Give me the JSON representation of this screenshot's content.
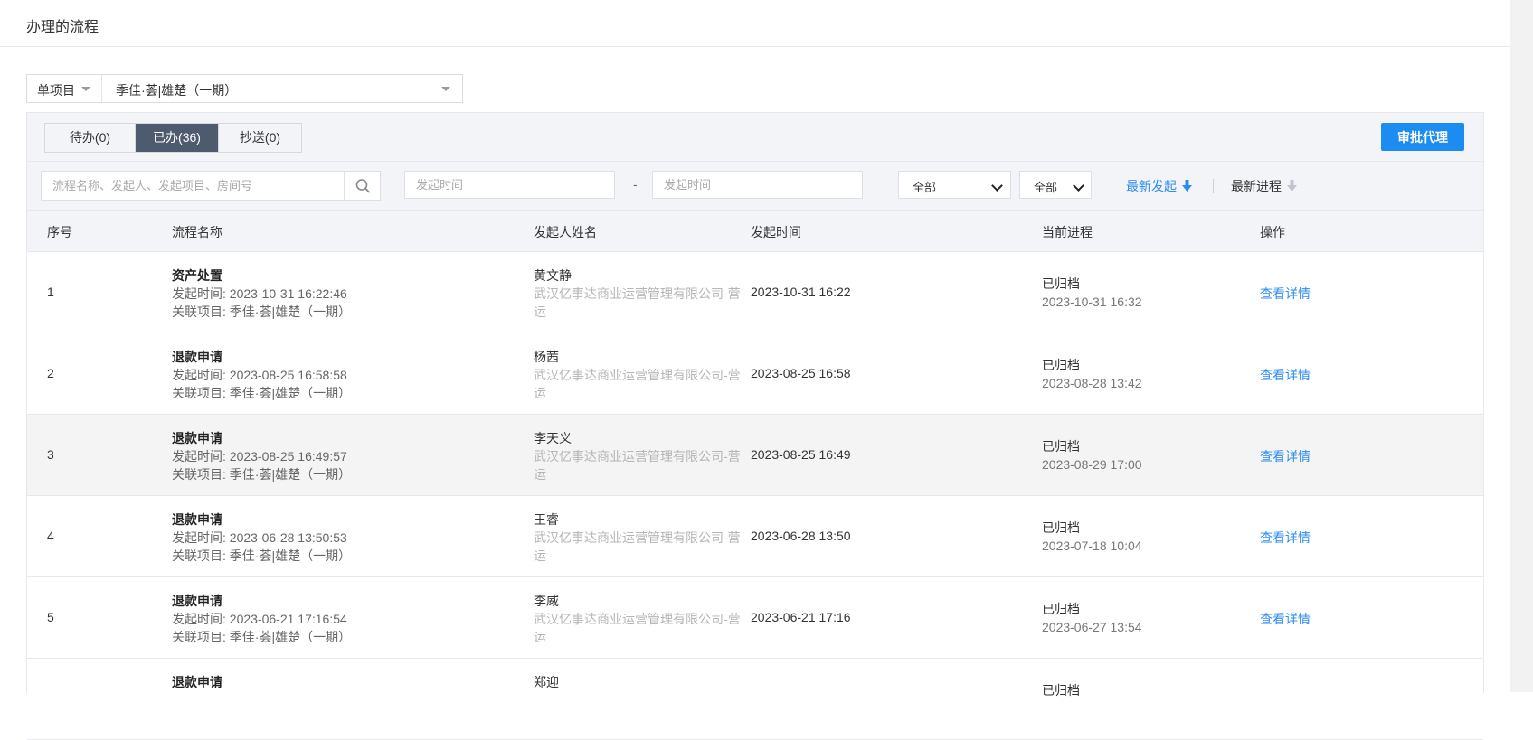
{
  "page": {
    "title": "办理的流程"
  },
  "filters": {
    "project_type": "单项目",
    "project_name": "季佳·荟|雄楚（一期）"
  },
  "tabs": [
    {
      "label": "待办(0)",
      "active": false
    },
    {
      "label": "已办(36)",
      "active": true
    },
    {
      "label": "抄送(0)",
      "active": false
    }
  ],
  "agent_button": "审批代理",
  "search": {
    "placeholder": "流程名称、发起人、发起项目、房间号",
    "start_date_placeholder": "发起时间",
    "end_date_placeholder": "发起时间",
    "separator": "-",
    "select1": "全部",
    "select2": "全部",
    "sort_latest_start": "最新发起",
    "sort_latest_progress": "最新进程"
  },
  "colors": {
    "accent": "#1d8cf0",
    "link": "#2d8cf0",
    "active_tab": "#4e5a6d",
    "sort_inactive": "#c0c4cc"
  },
  "table": {
    "headers": [
      "序号",
      "流程名称",
      "发起人姓名",
      "发起时间",
      "当前进程",
      "操作"
    ],
    "rows": [
      {
        "idx": "1",
        "name": "资产处置",
        "start_line": "发起时间: 2023-10-31 16:22:46",
        "project_line": "关联项目: 季佳·荟|雄楚（一期）",
        "person": "黄文静",
        "org": "武汉亿事达商业运营管理有限公司-营运",
        "time": "2023-10-31 16:22",
        "status": "已归档",
        "status_time": "2023-10-31 16:32",
        "action": "查看详情"
      },
      {
        "idx": "2",
        "name": "退款申请",
        "start_line": "发起时间: 2023-08-25 16:58:58",
        "project_line": "关联项目: 季佳·荟|雄楚（一期）",
        "person": "杨茜",
        "org": "武汉亿事达商业运营管理有限公司-营运",
        "time": "2023-08-25 16:58",
        "status": "已归档",
        "status_time": "2023-08-28 13:42",
        "action": "查看详情"
      },
      {
        "idx": "3",
        "name": "退款申请",
        "start_line": "发起时间: 2023-08-25 16:49:57",
        "project_line": "关联项目: 季佳·荟|雄楚（一期）",
        "person": "李天义",
        "org": "武汉亿事达商业运营管理有限公司-营运",
        "time": "2023-08-25 16:49",
        "status": "已归档",
        "status_time": "2023-08-29 17:00",
        "action": "查看详情"
      },
      {
        "idx": "4",
        "name": "退款申请",
        "start_line": "发起时间: 2023-06-28 13:50:53",
        "project_line": "关联项目: 季佳·荟|雄楚（一期）",
        "person": "王睿",
        "org": "武汉亿事达商业运营管理有限公司-营运",
        "time": "2023-06-28 13:50",
        "status": "已归档",
        "status_time": "2023-07-18 10:04",
        "action": "查看详情"
      },
      {
        "idx": "5",
        "name": "退款申请",
        "start_line": "发起时间: 2023-06-21 17:16:54",
        "project_line": "关联项目: 季佳·荟|雄楚（一期）",
        "person": "李威",
        "org": "武汉亿事达商业运营管理有限公司-营运",
        "time": "2023-06-21 17:16",
        "status": "已归档",
        "status_time": "2023-06-27 13:54",
        "action": "查看详情"
      },
      {
        "idx": "",
        "name": "退款申请",
        "start_line": "",
        "project_line": "",
        "person": "郑迎",
        "org": "",
        "time": "",
        "status": "已归档",
        "status_time": "",
        "action": ""
      }
    ]
  }
}
